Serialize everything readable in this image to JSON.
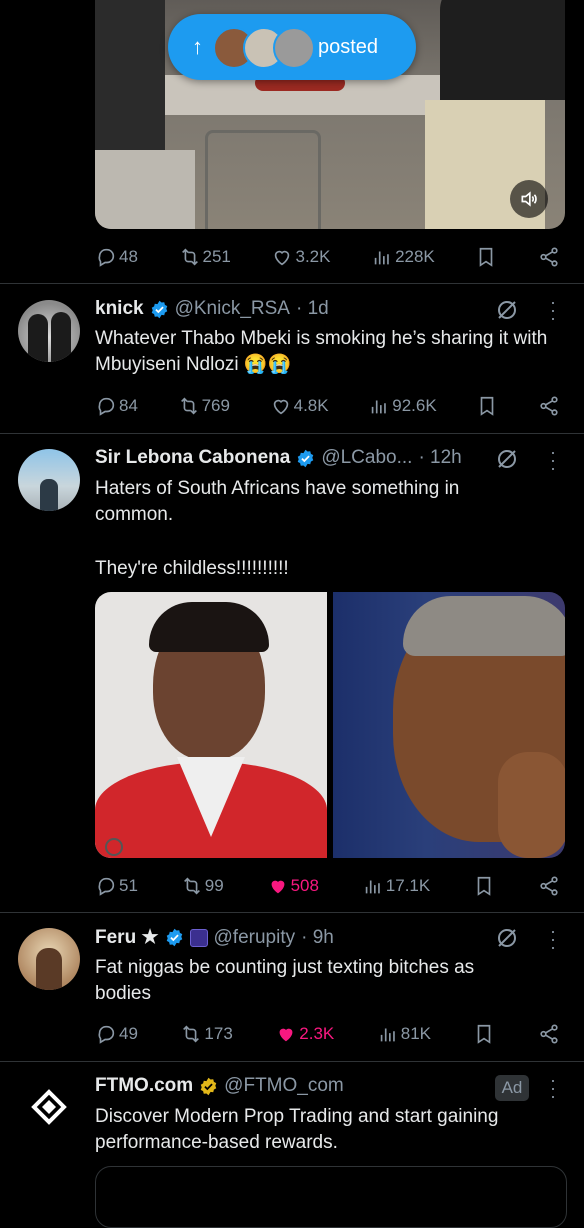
{
  "banner": {
    "label": "posted"
  },
  "tweet0": {
    "reply": "48",
    "retweet": "251",
    "like": "3.2K",
    "views": "228K"
  },
  "tweet1": {
    "name": "knick",
    "handle": "@Knick_RSA",
    "time": "· 1d",
    "text": "Whatever Thabo Mbeki is smoking he’s sharing it with Mbuyiseni Ndlozi 😭😭",
    "reply": "84",
    "retweet": "769",
    "like": "4.8K",
    "views": "92.6K"
  },
  "tweet2": {
    "name": "Sir Lebona Cabonena",
    "handle": "@LCabo...",
    "time": "· 12h",
    "text1": "Haters of South Africans have something in common.",
    "text2": "They're childless!!!!!!!!!!",
    "reply": "51",
    "retweet": "99",
    "like": "508",
    "views": "17.1K"
  },
  "tweet3": {
    "name": "Feru ★",
    "handle": "@ferupity",
    "time": "· 9h",
    "text": "Fat niggas be counting just texting bitches as bodies",
    "reply": "49",
    "retweet": "173",
    "like": "2.3K",
    "views": "81K"
  },
  "tweet4": {
    "name": "FTMO.com",
    "handle": "@FTMO_com",
    "ad": "Ad",
    "text": "Discover Modern Prop Trading and start gaining performance-based rewards."
  },
  "colors": {
    "accent": "#1d9bf0",
    "like_active": "#f91880",
    "gold": "#e2b719",
    "muted": "#8b98a5"
  }
}
